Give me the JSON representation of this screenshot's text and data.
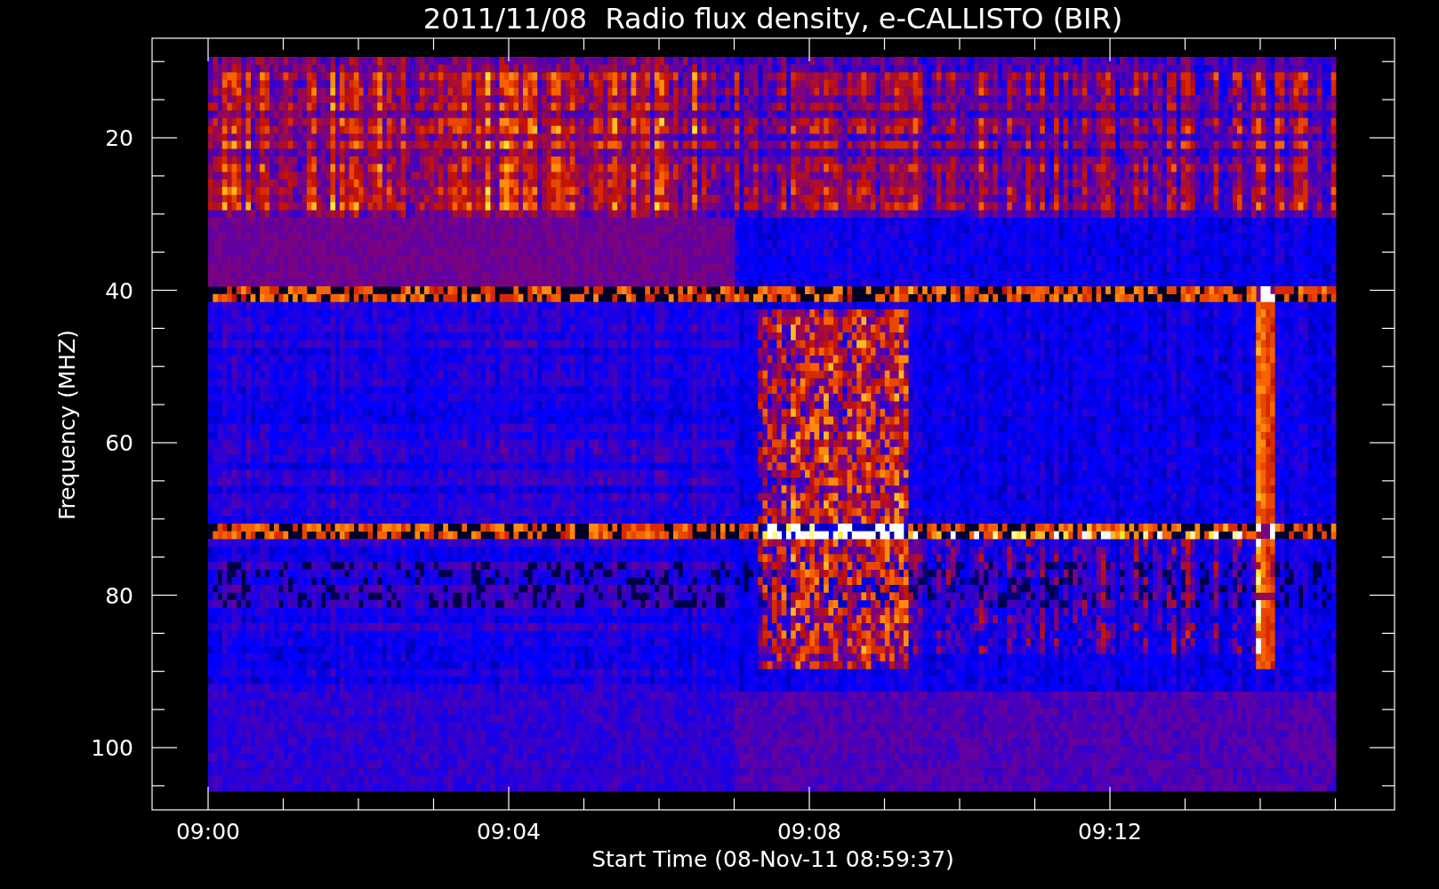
{
  "title": "2011/11/08  Radio flux density, e-CALLISTO (BIR)",
  "plot": {
    "ylabel": "Frequency (MHZ)",
    "y_tick_labels": [
      "20",
      "40",
      "60",
      "80",
      "100"
    ],
    "x_tick_labels": [
      "09:00",
      "09:04",
      "09:08",
      "09:12"
    ],
    "xlabel": "Start Time (08-Nov-11 08:59:37)"
  }
}
